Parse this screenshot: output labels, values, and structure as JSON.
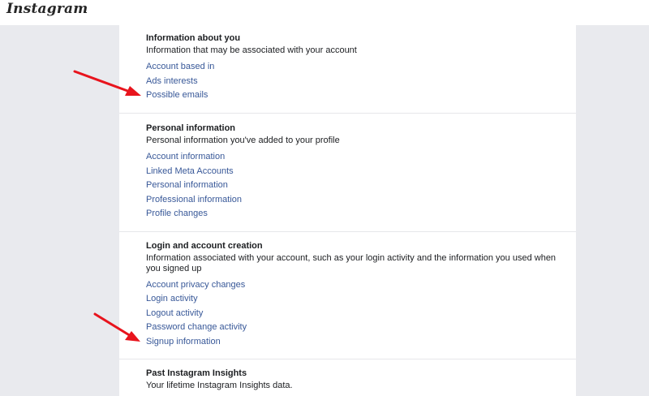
{
  "header": {
    "logo_text": "Instagram"
  },
  "sections": [
    {
      "title": "Information about you",
      "description": "Information that may be associated with your account",
      "links": [
        "Account based in",
        "Ads interests",
        "Possible emails"
      ]
    },
    {
      "title": "Personal information",
      "description": "Personal information you've added to your profile",
      "links": [
        "Account information",
        "Linked Meta Accounts",
        "Personal information",
        "Professional information",
        "Profile changes"
      ]
    },
    {
      "title": "Login and account creation",
      "description": "Information associated with your account, such as your login activity and the information you used when you signed up",
      "links": [
        "Account privacy changes",
        "Login activity",
        "Logout activity",
        "Password change activity",
        "Signup information"
      ]
    },
    {
      "title": "Past Instagram Insights",
      "description": "Your lifetime Instagram Insights data.",
      "links": []
    }
  ],
  "colors": {
    "link": "#385898",
    "annotation_arrow": "#e8141d",
    "background": "#e9eaee"
  }
}
